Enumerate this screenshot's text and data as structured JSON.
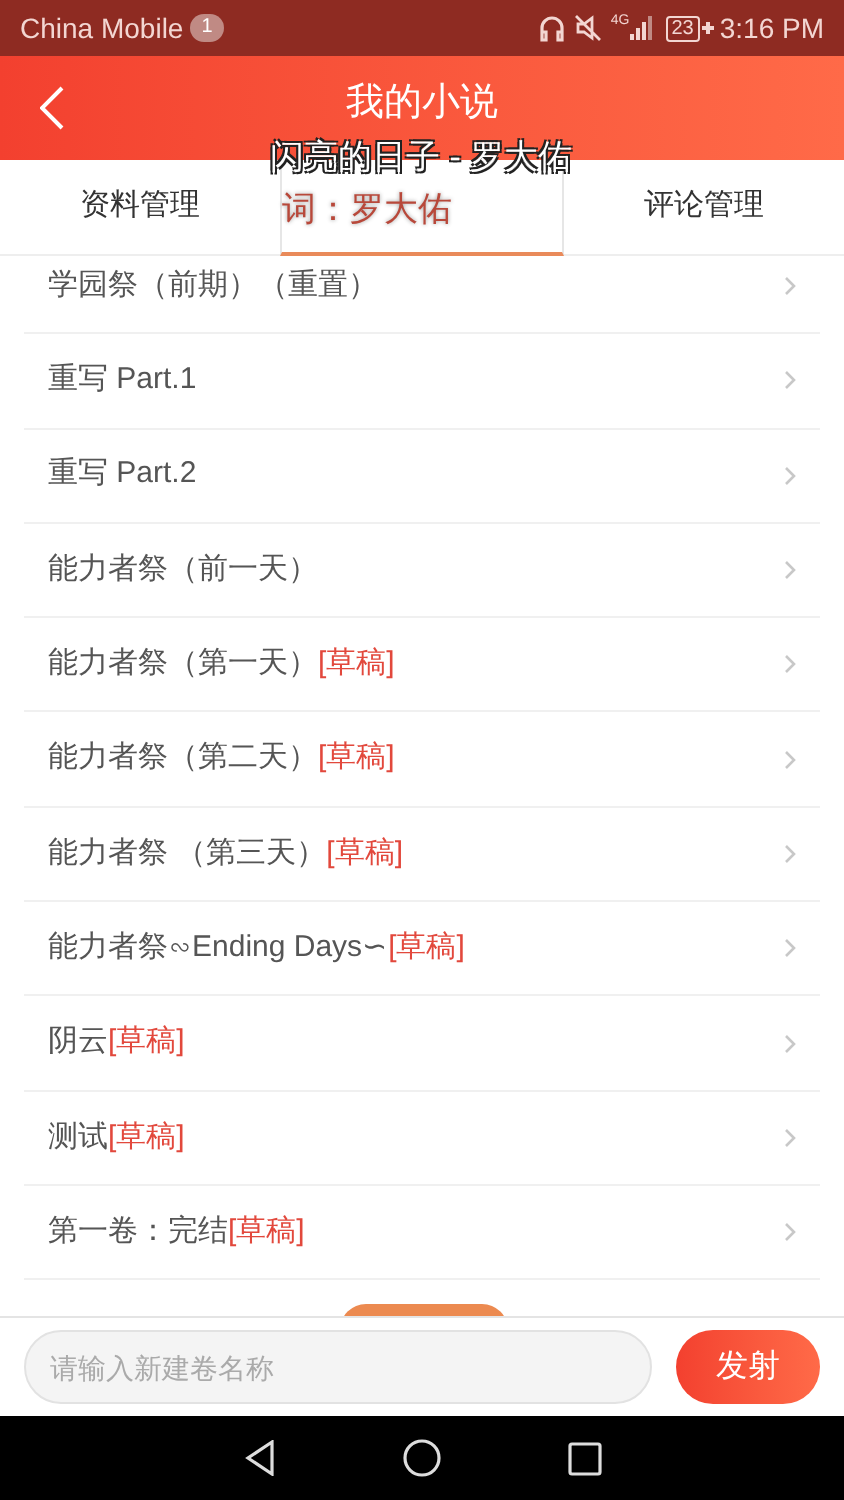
{
  "status_bar": {
    "carrier": "China Mobile",
    "notification_count": "1",
    "network": "4G",
    "battery": "23",
    "time": "3:16 PM"
  },
  "header": {
    "title": "我的小说"
  },
  "lyrics_overlay": [
    "闪亮的日子 - 罗大佑",
    "词：罗大佑"
  ],
  "tabs": [
    {
      "label": "资料管理",
      "selected": false
    },
    {
      "selected": true
    },
    {
      "label": "评论管理",
      "selected": false
    }
  ],
  "chapters": [
    {
      "title": "学园祭（前期）（重置）"
    },
    {
      "title": "重写 Part.1"
    },
    {
      "title": "重写 Part.2"
    },
    {
      "title": "能力者祭（前一天）"
    },
    {
      "title": "能力者祭（第一天）",
      "tag": "[草稿]"
    },
    {
      "title": "能力者祭（第二天）",
      "tag": "[草稿]"
    },
    {
      "title": "能力者祭 （第三天）",
      "tag": "[草稿]"
    },
    {
      "title": "能力者祭∽Ending Days∽",
      "tag": "[草稿]"
    },
    {
      "title": "阴云",
      "tag": "[草稿]"
    },
    {
      "title": "测试",
      "tag": "[草稿]"
    },
    {
      "title": "第一卷：完结",
      "tag": "[草稿]"
    }
  ],
  "composer": {
    "placeholder": "请输入新建卷名称",
    "button": "发射"
  }
}
